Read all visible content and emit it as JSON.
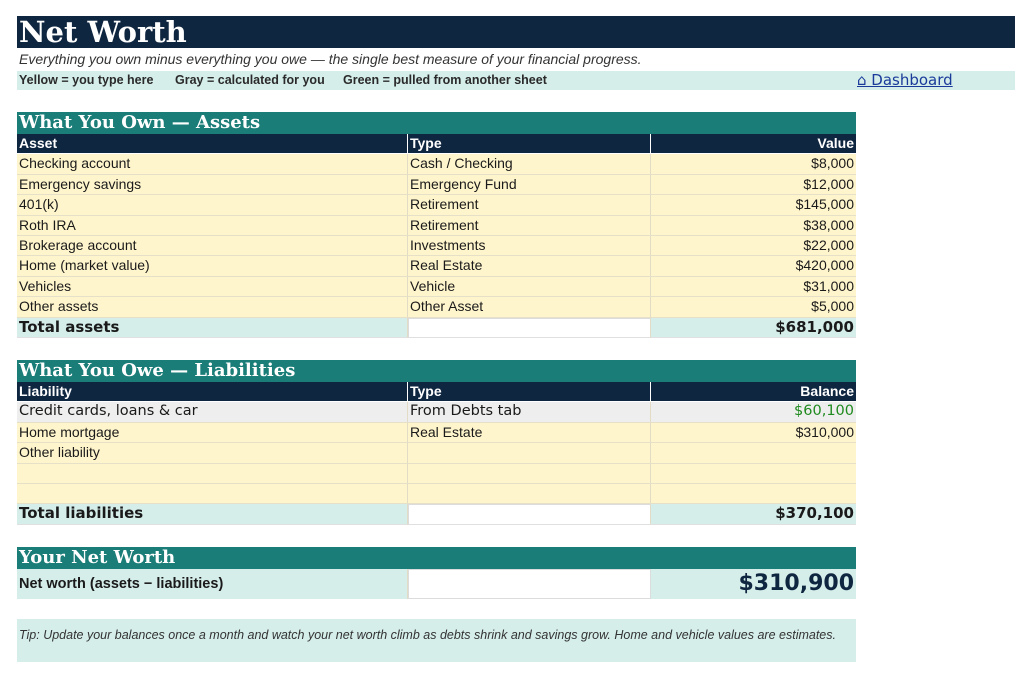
{
  "header": {
    "title": "Net Worth",
    "subtitle": "Everything you own minus everything you owe — the single best measure of your financial progress.",
    "legend": {
      "yellow": "Yellow = you type here",
      "gray": "Gray = calculated for you",
      "green": "Green = pulled from another sheet"
    },
    "dashboard_link": "⌂ Dashboard"
  },
  "assets": {
    "section_title": "What You Own — Assets",
    "columns": [
      "Asset",
      "Type",
      "Value"
    ],
    "rows": [
      {
        "name": "Checking account",
        "type": "Cash / Checking",
        "value": "$8,000"
      },
      {
        "name": "Emergency savings",
        "type": "Emergency Fund",
        "value": "$12,000"
      },
      {
        "name": "401(k)",
        "type": "Retirement",
        "value": "$145,000"
      },
      {
        "name": "Roth IRA",
        "type": "Retirement",
        "value": "$38,000"
      },
      {
        "name": "Brokerage account",
        "type": "Investments",
        "value": "$22,000"
      },
      {
        "name": "Home (market value)",
        "type": "Real Estate",
        "value": "$420,000"
      },
      {
        "name": "Vehicles",
        "type": "Vehicle",
        "value": "$31,000"
      },
      {
        "name": "Other assets",
        "type": "Other Asset",
        "value": "$5,000"
      }
    ],
    "total_label": "Total assets",
    "total_value": "$681,000"
  },
  "liabilities": {
    "section_title": "What You Owe — Liabilities",
    "columns": [
      "Liability",
      "Type",
      "Balance"
    ],
    "linked_row": {
      "name": "Credit cards, loans & car",
      "type": "From Debts tab",
      "value": "$60,100"
    },
    "rows": [
      {
        "name": "Home mortgage",
        "type": "Real Estate",
        "value": "$310,000"
      },
      {
        "name": "Other liability",
        "type": "",
        "value": ""
      },
      {
        "name": "",
        "type": "",
        "value": ""
      },
      {
        "name": "",
        "type": "",
        "value": ""
      }
    ],
    "total_label": "Total liabilities",
    "total_value": "$370,100"
  },
  "net_worth": {
    "section_title": "Your Net Worth",
    "label": "Net worth (assets − liabilities)",
    "value": "$310,900"
  },
  "tip": "Tip:  Update your balances once a month and watch your net worth climb as debts shrink and savings grow. Home and vehicle values are estimates.",
  "colors": {
    "navy": "#0f2640",
    "teal": "#1a7d78",
    "input_yellow": "#fff5cc",
    "calc_gray": "#eeeeee",
    "linked_green": "#1f8a1f",
    "mint": "#d5eeea"
  }
}
